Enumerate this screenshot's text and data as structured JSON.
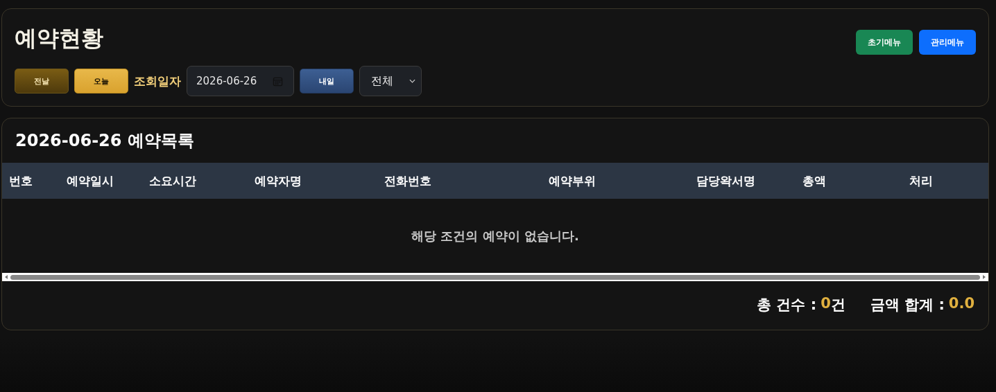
{
  "header": {
    "title": "예약현황",
    "menu_buttons": [
      {
        "label": "초기메뉴",
        "kind": "green"
      },
      {
        "label": "관리메뉴",
        "kind": "blue"
      }
    ]
  },
  "toolbar": {
    "prev_button": "전날",
    "today_button": "오늘",
    "date_label": "조회일자",
    "date_field": {
      "value": "2026-06-26"
    },
    "next_button": "내일",
    "filter": {
      "value": "전체"
    }
  },
  "list": {
    "title": "2026-06-26 예약목록",
    "table": {
      "columns": [
        "번호",
        "예약일시",
        "소요시간",
        "예약자명",
        "전화번호",
        "예약부위",
        "담당왁서명",
        "총액",
        "처리"
      ],
      "empty_message": "해당 조건의 예약이 없습니다."
    },
    "summary": [
      {
        "label": "총 건수 :",
        "value": "0",
        "unit": "건"
      },
      {
        "label": "금액 합계 :",
        "value": "0.0"
      }
    ]
  }
}
